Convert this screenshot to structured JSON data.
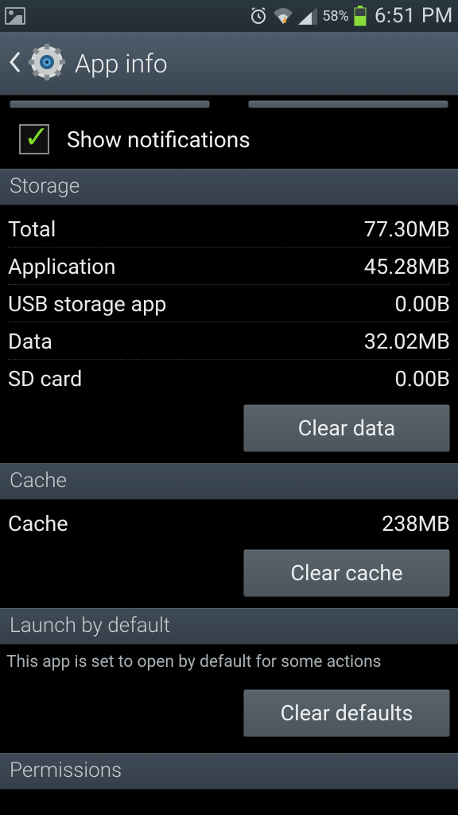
{
  "status": {
    "battery_pct": "58%",
    "time": "6:51 PM"
  },
  "header": {
    "title": "App info"
  },
  "notifications": {
    "label": "Show notifications",
    "checked": true
  },
  "sections": {
    "storage": {
      "title": "Storage",
      "rows": [
        {
          "label": "Total",
          "value": "77.30MB"
        },
        {
          "label": "Application",
          "value": "45.28MB"
        },
        {
          "label": "USB storage app",
          "value": "0.00B"
        },
        {
          "label": "Data",
          "value": "32.02MB"
        },
        {
          "label": "SD card",
          "value": "0.00B"
        }
      ],
      "clear_btn": "Clear data"
    },
    "cache": {
      "title": "Cache",
      "row": {
        "label": "Cache",
        "value": "238MB"
      },
      "clear_btn": "Clear cache"
    },
    "launch": {
      "title": "Launch by default",
      "info": "This app is set to open by default for some actions",
      "clear_btn": "Clear defaults"
    },
    "permissions": {
      "title": "Permissions"
    }
  }
}
